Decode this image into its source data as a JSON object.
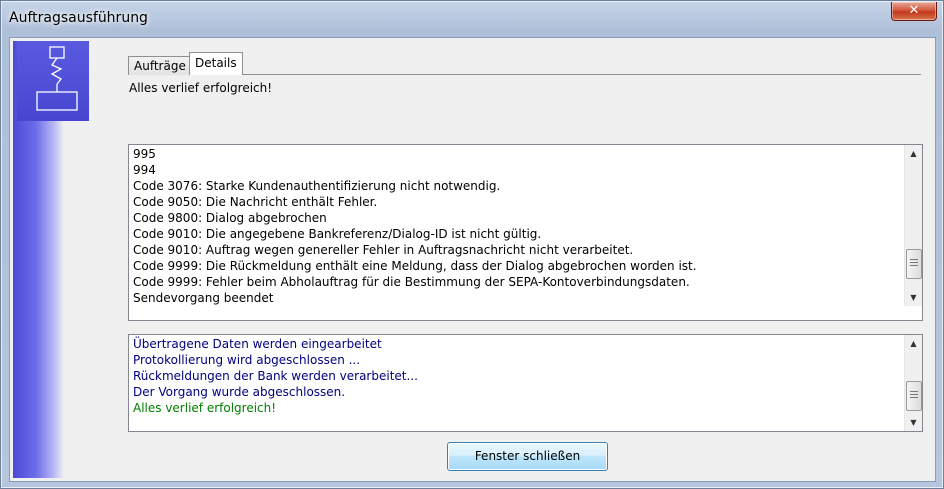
{
  "window": {
    "title": "Auftragsausführung",
    "close_glyph": "✕"
  },
  "tabs": [
    {
      "label": "Aufträge",
      "active": false
    },
    {
      "label": "Details",
      "active": true
    }
  ],
  "status_message": "Alles verlief erfolgreich!",
  "details_log": {
    "lines": [
      "995",
      "994",
      "Code 3076: Starke Kundenauthentifizierung nicht notwendig.",
      "Code 9050: Die Nachricht enthält Fehler.",
      "Code 9800: Dialog abgebrochen",
      "Code 9010: Die angegebene Bankreferenz/Dialog-ID ist nicht gültig.",
      "Code 9010: Auftrag wegen genereller Fehler in Auftragsnachricht nicht verarbeitet.",
      "Code 9999: Die Rückmeldung enthält eine Meldung, dass der Dialog abgebrochen worden ist.",
      "Code 9999: Fehler beim Abholauftrag für die Bestimmung der SEPA-Kontoverbindungsdaten.",
      "Sendevorgang beendet"
    ],
    "scroll_position": 0.9
  },
  "progress_log": {
    "lines": [
      {
        "text": "Übertragene Daten werden eingearbeitet",
        "color": "#000080"
      },
      {
        "text": "Protokollierung wird abgeschlossen ...",
        "color": "#000080"
      },
      {
        "text": "Rückmeldungen der Bank werden verarbeitet...",
        "color": "#000080"
      },
      {
        "text": "Der Vorgang wurde abgeschlossen.",
        "color": "#000080"
      },
      {
        "text": "Alles verlief erfolgreich!",
        "color": "#008000"
      }
    ],
    "scroll_position": 0.9
  },
  "buttons": {
    "close_window_label": "Fenster schließen"
  },
  "icons": {
    "scroll_up": "▲",
    "scroll_down": "▼"
  }
}
